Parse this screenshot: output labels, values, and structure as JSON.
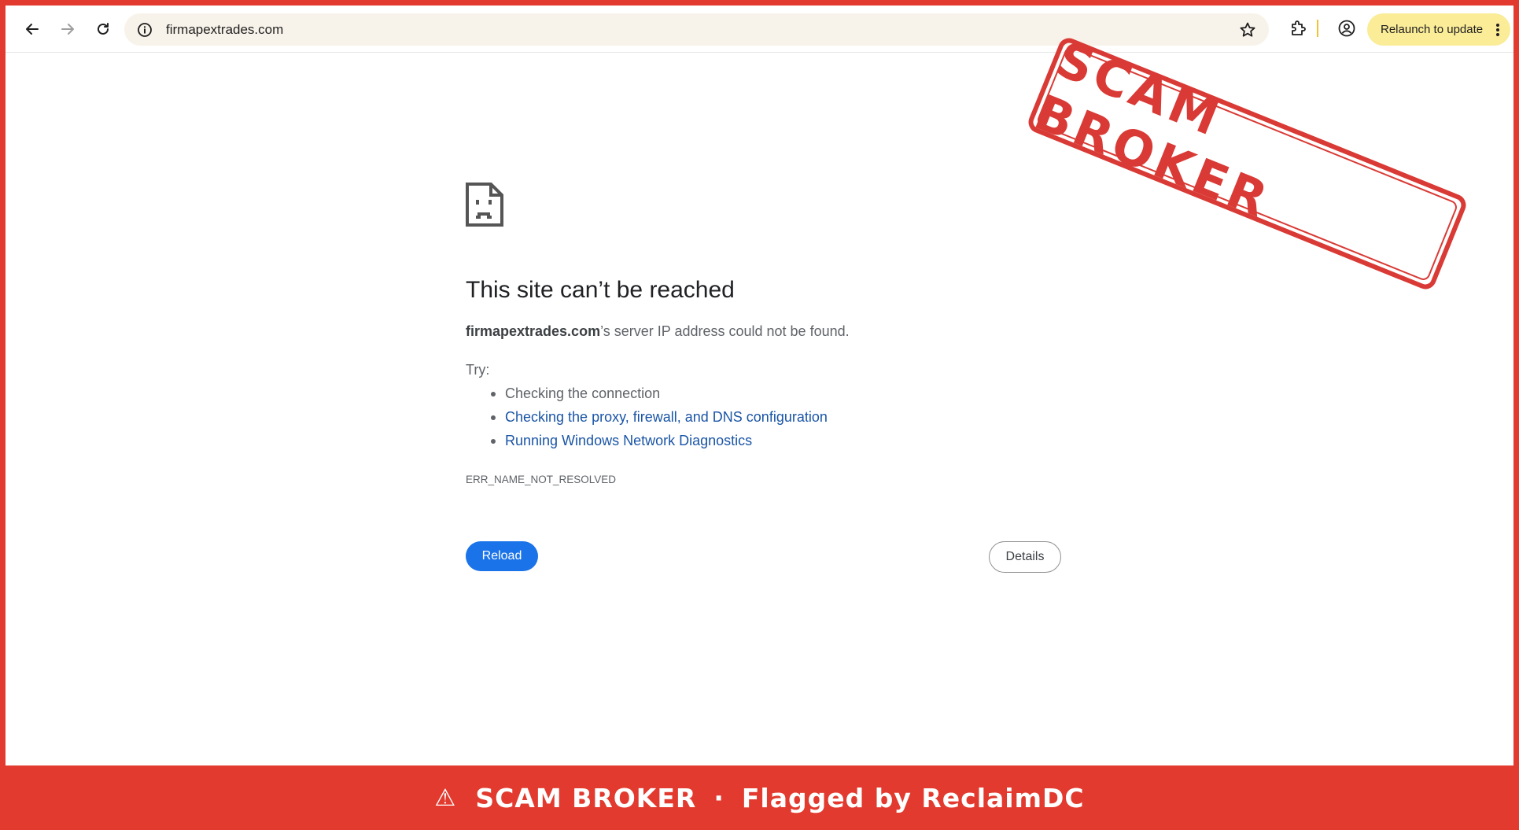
{
  "browser": {
    "url": "firmapextrades.com",
    "relaunch_label": "Relaunch to update"
  },
  "error_page": {
    "title": "This site can’t be reached",
    "domain": "firmapextrades.com",
    "description_suffix": "’s server IP address could not be found.",
    "try_label": "Try:",
    "suggestions": [
      "Checking the connection",
      "Checking the proxy, firewall, and DNS configuration",
      "Running Windows Network Diagnostics"
    ],
    "error_code": "ERR_NAME_NOT_RESOLVED",
    "reload_label": "Reload",
    "details_label": "Details"
  },
  "stamp": {
    "text": "SCAM BROKER"
  },
  "banner": {
    "warning_icon": "⚠",
    "label": "SCAM BROKER",
    "separator": "·",
    "flagged_text": "Flagged by ReclaimDC"
  },
  "colors": {
    "alert_red": "#e23a2e",
    "stamp_red": "#d93a35",
    "link_blue": "#1a55a6",
    "button_blue": "#1a73e8",
    "relaunch_yellow": "#fbec98"
  }
}
